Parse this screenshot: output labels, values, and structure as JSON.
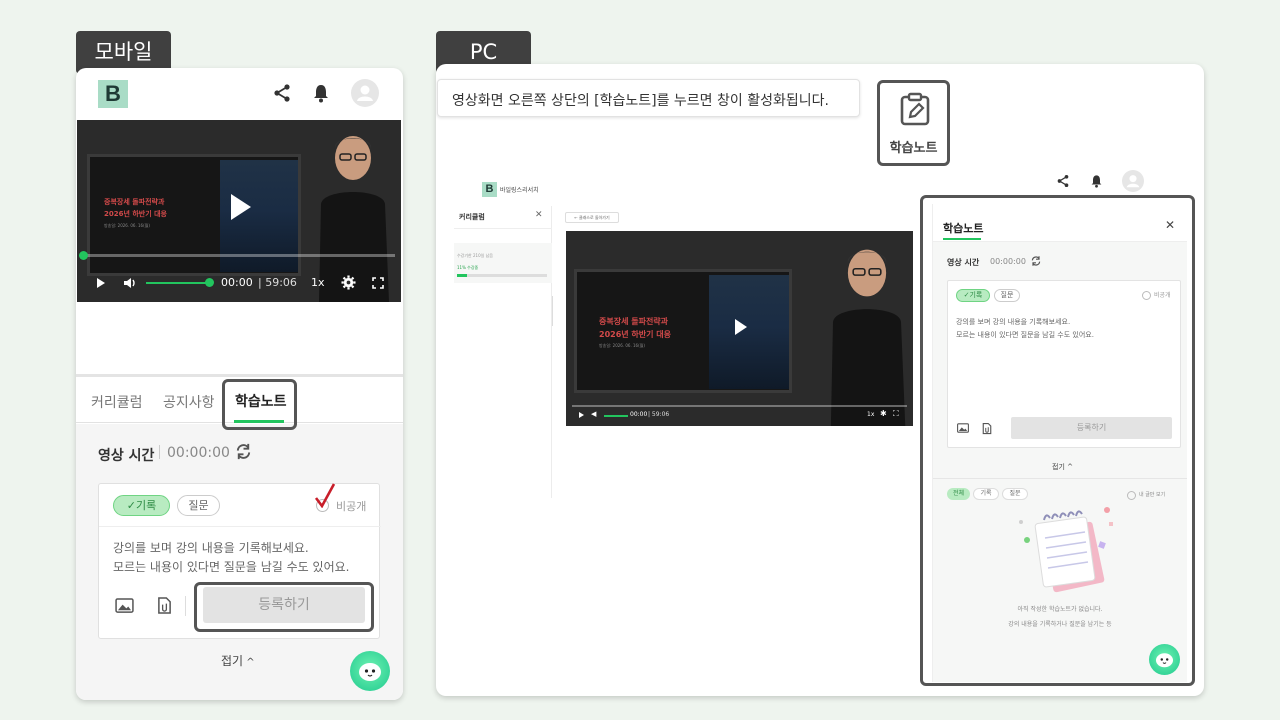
{
  "labels": {
    "mobile": "모바일",
    "pc": "PC"
  },
  "callout": {
    "text": "영상화면 오른쪽 상단의 [학습노트]를 누르면 창이 활성화됩니다."
  },
  "note_button": {
    "label": "학습노트"
  },
  "mobile": {
    "logo": "B",
    "video": {
      "screen_line1": "중복장세 돌파전략과",
      "screen_line2": "2026년 하반기 대응",
      "screen_date": "방송일: 2026. 06. 16(월)",
      "time_current": "00:00",
      "time_total": "| 59:06",
      "speed": "1x"
    },
    "tabs": [
      "커리큘럼",
      "공지사항",
      "학습노트"
    ],
    "video_time_label": "영상 시간",
    "video_time_value": "00:00:00",
    "chip_record": "✓기록",
    "chip_question": "질문",
    "private_label": "비공개",
    "placeholder_line1": "강의를 보며 강의 내용을 기록해보세요.",
    "placeholder_line2": "모르는 내용이 있다면 질문을 남길 수도 있어요.",
    "submit": "등록하기",
    "collapse": "접기"
  },
  "pc": {
    "logo": "B",
    "site_name": "바일링스리서치",
    "sidebar_title": "커리큘럼",
    "progress_caption": "수강기한 210일 남음",
    "progress_text": "11% 수강중",
    "progress": 0.11,
    "back_label": "← 클래스로 돌아가기",
    "video": {
      "screen_line1": "중복장세 돌파전략과",
      "screen_line2": "2026년 하반기 대응",
      "screen_date": "방송일: 2026. 06. 16(월)",
      "time_current": "00:00",
      "time_total": "| 59:06",
      "speed": "1x"
    },
    "note_panel": {
      "title": "학습노트",
      "video_time_label": "영상 시간",
      "video_time_value": "00:00:00",
      "chip_record": "✓기록",
      "chip_question": "질문",
      "private_label": "비공개",
      "placeholder_line1": "강의를 보며 강의 내용을 기록해보세요.",
      "placeholder_line2": "모르는 내용이 있다면 질문을 남길 수도 있어요.",
      "submit": "등록하기",
      "collapse": "접기 ^",
      "filters": [
        "전체",
        "기록",
        "질문"
      ],
      "my_posts": "내 글만 보기",
      "empty_line1": "아직 작성한 학습노트가 없습니다.",
      "empty_line2": "강의 내용을 기록하거나 질문을 남기는 등"
    }
  },
  "colors": {
    "accent": "#22c55e",
    "chip_bg": "#b8ebc1",
    "logo_bg": "#a9dcc6",
    "label_bg": "#404040"
  }
}
